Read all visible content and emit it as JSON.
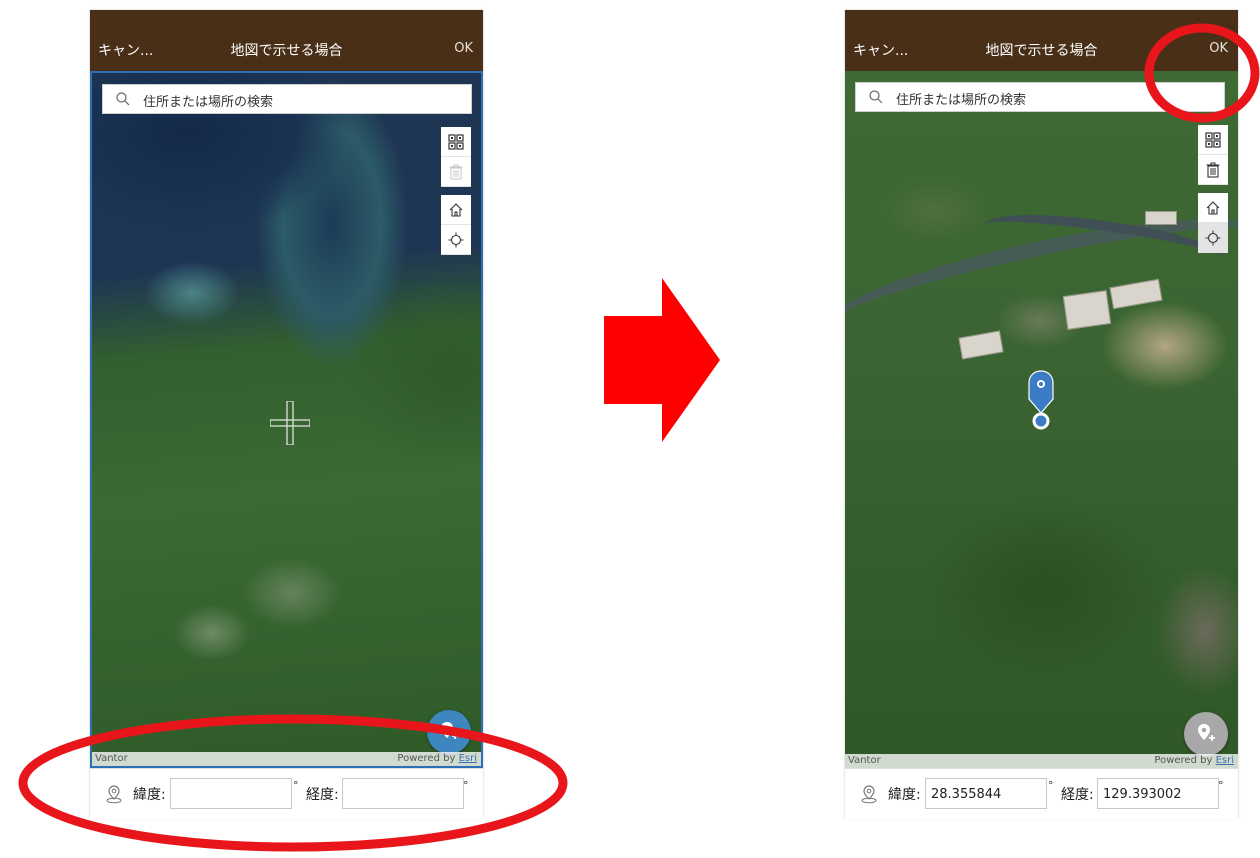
{
  "colors": {
    "header_bg": "#4a2f18",
    "highlight_red": "#e8161b",
    "arrow_red": "#ff0000",
    "fab_blue": "#3d86be",
    "fab_grey": "#a8a8a8",
    "pin_blue": "#3b7cc4"
  },
  "before": {
    "header": {
      "cancel": "キャン...",
      "title": "地図で示せる場合",
      "ok": "OK"
    },
    "search": {
      "placeholder": "住所または場所の検索",
      "icon": "search-icon"
    },
    "tools": [
      "qr-code-icon",
      "trash-icon",
      "home-icon",
      "locate-icon"
    ],
    "attribution": {
      "source": "Vantor",
      "powered_by": "Powered by",
      "esri": "Esri"
    },
    "coords": {
      "lat_label": "緯度:",
      "lon_label": "経度:",
      "lat_value": "",
      "lon_value": "",
      "unit": "°"
    }
  },
  "after": {
    "header": {
      "cancel": "キャン...",
      "title": "地図で示せる場合",
      "ok": "OK"
    },
    "search": {
      "placeholder": "住所または場所の検索",
      "icon": "search-icon"
    },
    "tools": [
      "qr-code-icon",
      "trash-icon",
      "home-icon",
      "locate-icon"
    ],
    "attribution": {
      "source": "Vantor",
      "powered_by": "Powered by",
      "esri": "Esri"
    },
    "coords": {
      "lat_label": "緯度:",
      "lon_label": "経度:",
      "lat_value": "28.355844",
      "lon_value": "129.393002",
      "unit": "°"
    }
  }
}
